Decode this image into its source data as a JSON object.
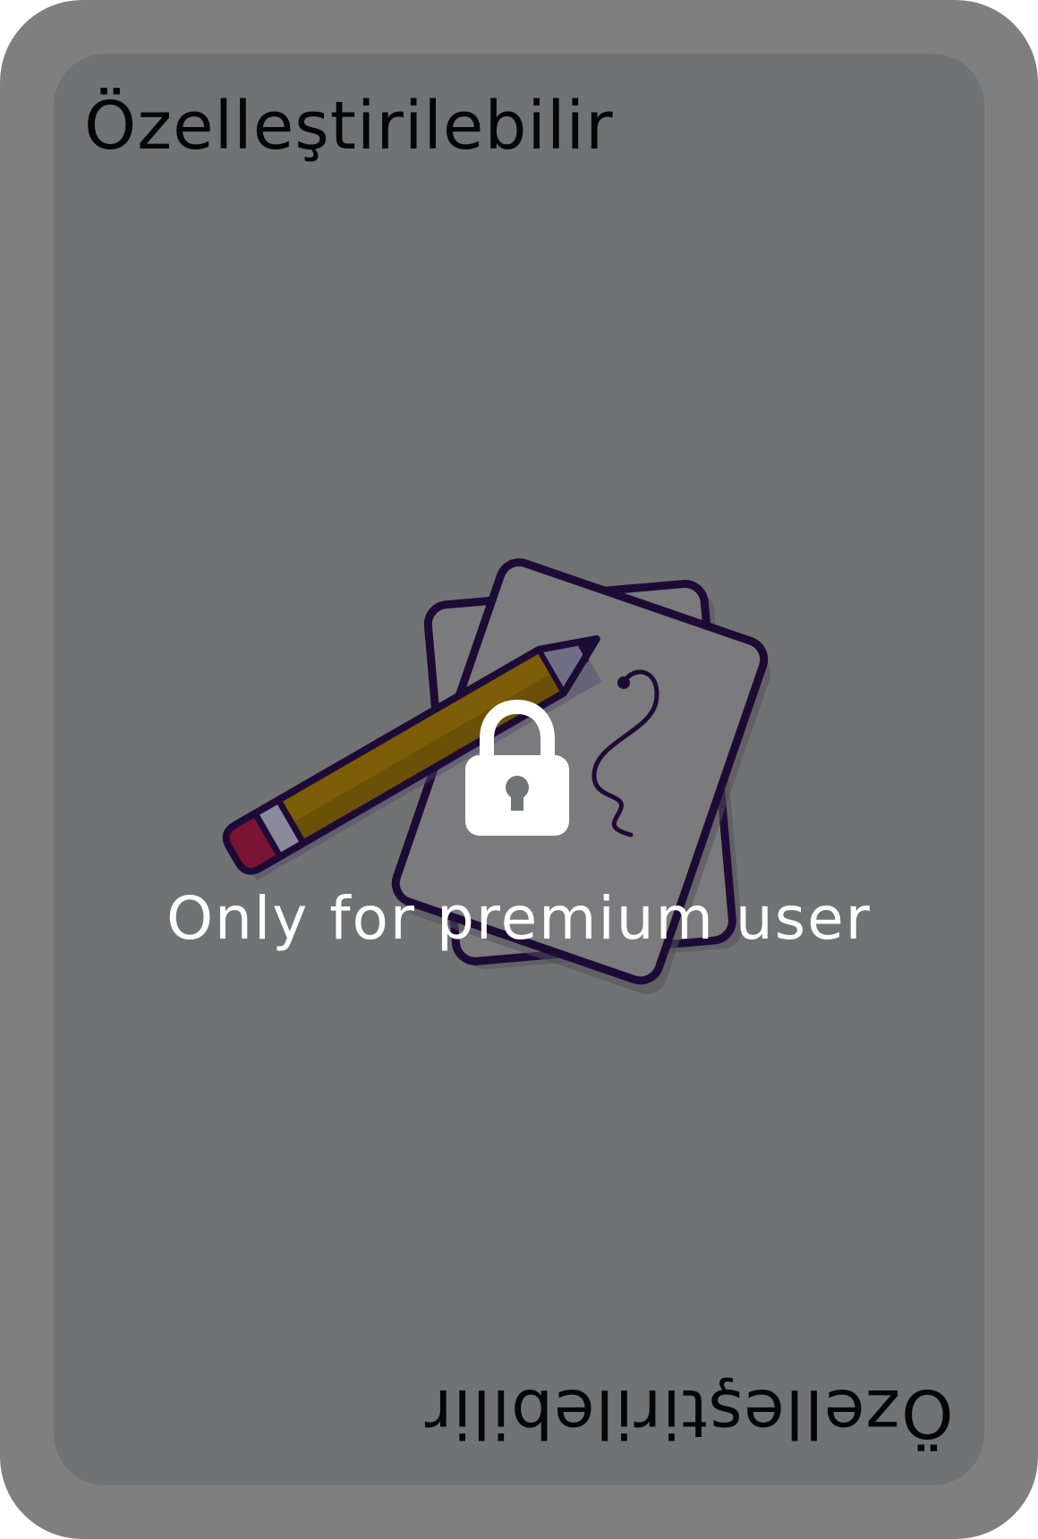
{
  "card": {
    "title_top": "Özelleştirilebilir",
    "title_bottom": "Özelleştirilebilir",
    "overlay_text": "Only for premium user",
    "illustration_icon": "cards-and-pencil-icon",
    "lock_icon": "lock-icon"
  },
  "colors": {
    "card_border": "#7f7f7f",
    "card_face": "#717274",
    "title_text": "#050505",
    "overlay_text": "#ffffff",
    "pencil_body": "#7d5d07",
    "pencil_eraser": "#7a1434",
    "outline": "#1e0b35"
  }
}
